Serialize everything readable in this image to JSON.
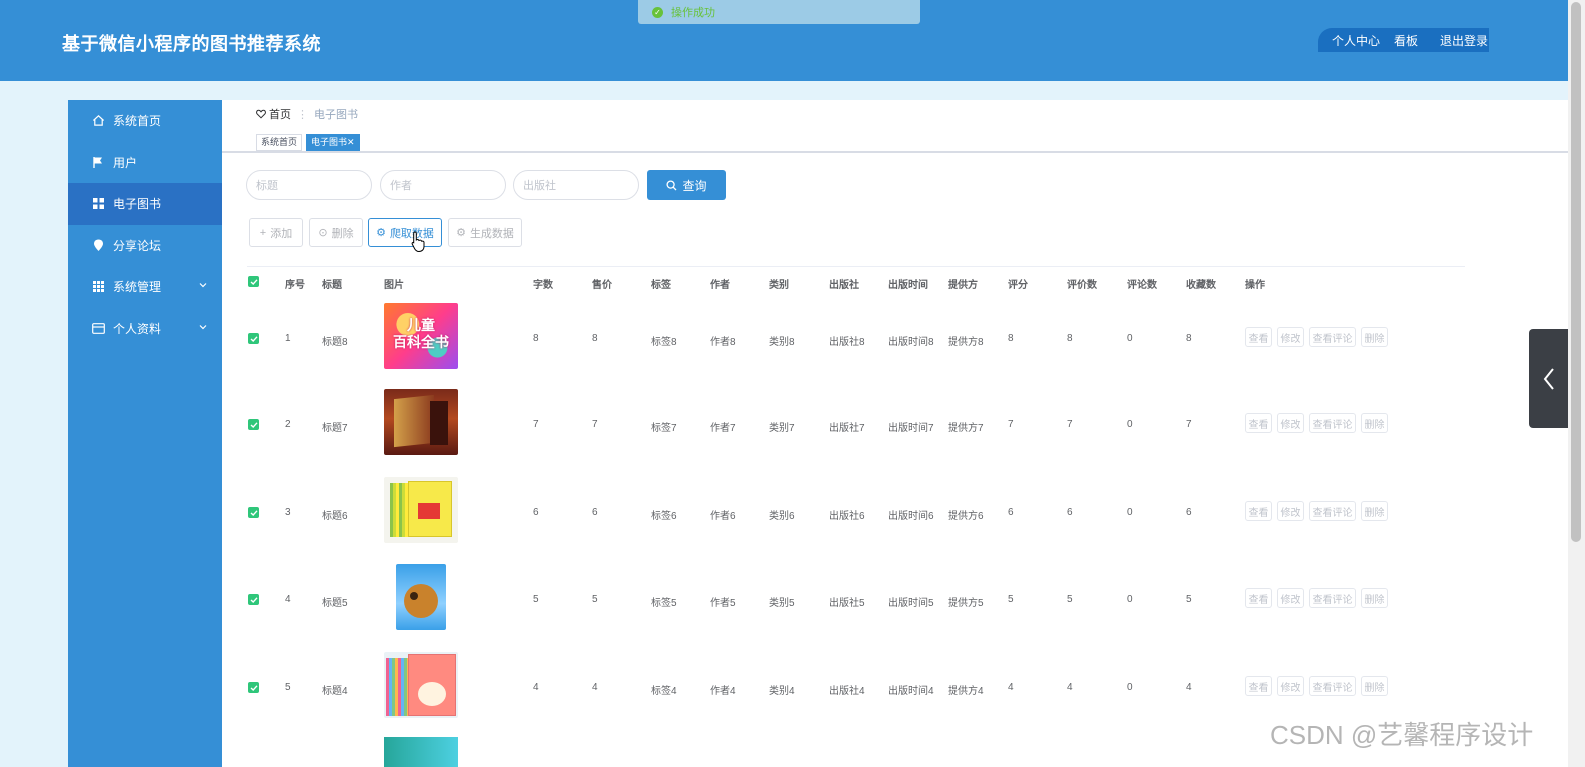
{
  "header": {
    "title": "基于微信小程序的图书推荐系统",
    "menu": [
      "个人中心",
      "看板",
      "退出登录"
    ]
  },
  "toast": {
    "message": "操作成功"
  },
  "sidebar": {
    "items": [
      {
        "label": "系统首页",
        "icon": "home-icon"
      },
      {
        "label": "用户",
        "icon": "flag-icon"
      },
      {
        "label": "电子图书",
        "icon": "grid-icon"
      },
      {
        "label": "分享论坛",
        "icon": "pin-icon"
      },
      {
        "label": "系统管理",
        "icon": "grid-icon"
      },
      {
        "label": "个人资料",
        "icon": "card-icon"
      }
    ]
  },
  "breadcrumb": {
    "home": "首页",
    "current": "电子图书"
  },
  "tags": [
    "系统首页",
    "电子图书"
  ],
  "search": {
    "title_placeholder": "标题",
    "author_placeholder": "作者",
    "publisher_placeholder": "出版社",
    "button": "查询"
  },
  "actions": {
    "add": "添加",
    "delete": "删除",
    "crawl": "爬取数据",
    "generate": "生成数据"
  },
  "table": {
    "headers": [
      "序号",
      "标题",
      "图片",
      "字数",
      "售价",
      "标签",
      "作者",
      "类别",
      "出版社",
      "出版时间",
      "提供方",
      "评分",
      "评价数",
      "评论数",
      "收藏数",
      "操作"
    ],
    "rows": [
      {
        "no": "1",
        "title": "标题8",
        "words": "8",
        "price": "8",
        "tag": "标签8",
        "author": "作者8",
        "category": "类别8",
        "publisher": "出版社8",
        "pubtime": "出版时间8",
        "provider": "提供方8",
        "score": "8",
        "reviews": "8",
        "comments": "0",
        "favorites": "8",
        "cover_text": "儿童\n百科全书"
      },
      {
        "no": "2",
        "title": "标题7",
        "words": "7",
        "price": "7",
        "tag": "标签7",
        "author": "作者7",
        "category": "类别7",
        "publisher": "出版社7",
        "pubtime": "出版时间7",
        "provider": "提供方7",
        "score": "7",
        "reviews": "7",
        "comments": "0",
        "favorites": "7"
      },
      {
        "no": "3",
        "title": "标题6",
        "words": "6",
        "price": "6",
        "tag": "标签6",
        "author": "作者6",
        "category": "类别6",
        "publisher": "出版社6",
        "pubtime": "出版时间6",
        "provider": "提供方6",
        "score": "6",
        "reviews": "6",
        "comments": "0",
        "favorites": "6"
      },
      {
        "no": "4",
        "title": "标题5",
        "words": "5",
        "price": "5",
        "tag": "标签5",
        "author": "作者5",
        "category": "类别5",
        "publisher": "出版社5",
        "pubtime": "出版时间5",
        "provider": "提供方5",
        "score": "5",
        "reviews": "5",
        "comments": "0",
        "favorites": "5"
      },
      {
        "no": "5",
        "title": "标题4",
        "words": "4",
        "price": "4",
        "tag": "标签4",
        "author": "作者4",
        "category": "类别4",
        "publisher": "出版社4",
        "pubtime": "出版时间4",
        "provider": "提供方4",
        "score": "4",
        "reviews": "4",
        "comments": "0",
        "favorites": "4"
      }
    ],
    "row_buttons": [
      "查看",
      "修改",
      "查看评论",
      "删除"
    ]
  },
  "watermark": "CSDN @艺馨程序设计",
  "colors": {
    "primary": "#358fd6",
    "active": "#2a71c4",
    "check": "#2fc67a",
    "background": "#e3f3fb"
  }
}
